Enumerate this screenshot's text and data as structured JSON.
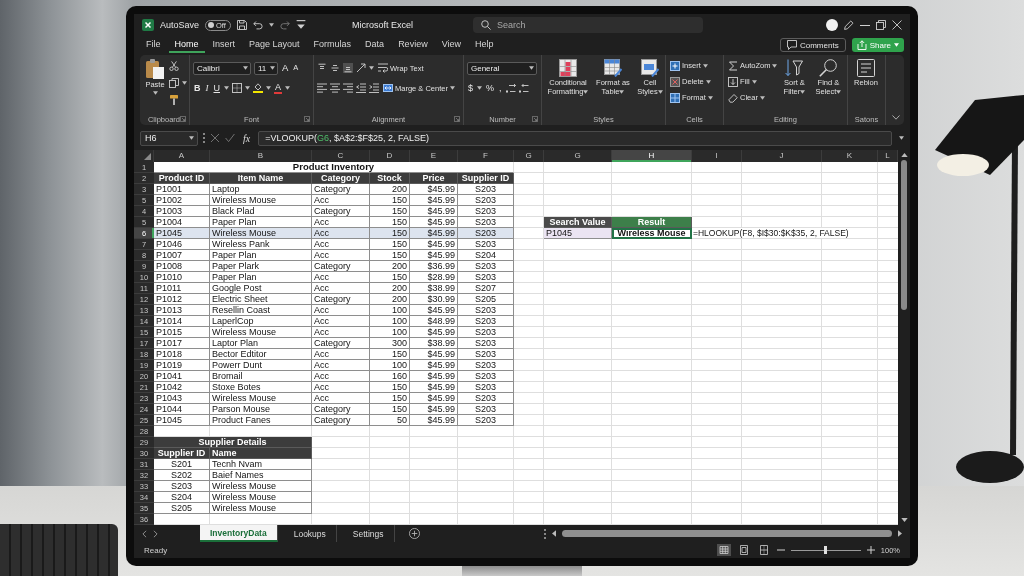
{
  "title_bar": {
    "autosave": {
      "label": "AutoSave",
      "toggle_text": "Off",
      "on": false
    },
    "title": "Microsoft Excel",
    "search": {
      "placeholder": "Search"
    }
  },
  "menu": {
    "tabs": [
      {
        "label": "File",
        "selected": false
      },
      {
        "label": "Home",
        "selected": true
      },
      {
        "label": "Insert",
        "selected": false
      },
      {
        "label": "Page Layout",
        "selected": false
      },
      {
        "label": "Formulas",
        "selected": false
      },
      {
        "label": "Data",
        "selected": false
      },
      {
        "label": "Review",
        "selected": false
      },
      {
        "label": "View",
        "selected": false
      },
      {
        "label": "Help",
        "selected": false
      }
    ],
    "comments": "Comments",
    "share": "Share"
  },
  "ribbon": {
    "groups": [
      {
        "kind": "clipboard",
        "label": "Clipboard",
        "paste": "Paste"
      },
      {
        "kind": "font",
        "label": "Font",
        "font_name": "Calibri",
        "font_size": "11",
        "size_buttons": [
          "A",
          "A"
        ],
        "style_buttons": [
          "B",
          "I",
          "U"
        ],
        "font_color": "A"
      },
      {
        "kind": "alignment",
        "label": "Alignment",
        "vertical_align": [
          {
            "selected": false
          },
          {
            "selected": false
          },
          {
            "selected": true
          }
        ],
        "wrap_text": "Wrap Text",
        "merge": "Marge & Center"
      },
      {
        "kind": "number",
        "label": "Number",
        "format": "General",
        "symbols": [
          "$",
          "%",
          ","
        ]
      },
      {
        "kind": "styles",
        "label": "Styles",
        "buttons": [
          "Conditional Formatting",
          "Format as Table",
          "Cell Styles"
        ]
      },
      {
        "kind": "cells",
        "label": "Cells",
        "buttons": [
          "Insert",
          "Delete",
          "Format"
        ]
      },
      {
        "kind": "editing",
        "label": "Editing",
        "list": [
          "AutoZom",
          "Fill",
          "Clear"
        ],
        "buttons": [
          "Sort & Filter",
          "Find & Select"
        ]
      },
      {
        "kind": "addins",
        "label": "Satons",
        "buttons": [
          "Rebion"
        ]
      }
    ]
  },
  "formula_bar": {
    "name_box": "H6",
    "fx": "fx",
    "formula": [
      {
        "text": "=VLOOKUP(",
        "ref": false
      },
      {
        "text": "G6",
        "ref": true
      },
      {
        "text": ", $A$2:$F$25, 2, FALSE)",
        "ref": false
      }
    ]
  },
  "sheet": {
    "columns": [
      {
        "label": "A",
        "selected": false
      },
      {
        "label": "B",
        "selected": false
      },
      {
        "label": "C",
        "selected": false
      },
      {
        "label": "D",
        "selected": false
      },
      {
        "label": "E",
        "selected": false
      },
      {
        "label": "F",
        "selected": false
      },
      {
        "label": "G",
        "selected": false
      },
      {
        "label": "G",
        "selected": false
      },
      {
        "label": "H",
        "selected": true
      },
      {
        "label": "I",
        "selected": false
      },
      {
        "label": "J",
        "selected": false
      },
      {
        "label": "K",
        "selected": false
      },
      {
        "label": "L",
        "selected": false
      }
    ],
    "inventory": {
      "title_row": "1",
      "title": "Product Inventory",
      "header_row": "2",
      "headers": [
        "Product ID",
        "Item Name",
        "Category",
        "Stock",
        "Price",
        "Supplier ID"
      ],
      "rows": [
        {
          "row": "3",
          "cells": [
            "P1001",
            "Laptop",
            "Category",
            "200",
            "$45.99",
            "S203"
          ],
          "selected": false
        },
        {
          "row": "5",
          "cells": [
            "P1002",
            "Wireless Mouse",
            "Acc",
            "150",
            "$45.99",
            "S203"
          ],
          "selected": false
        },
        {
          "row": "4",
          "cells": [
            "P1003",
            "Black Plad",
            "Category",
            "150",
            "$45.99",
            "S203"
          ],
          "selected": false
        },
        {
          "row": "5",
          "cells": [
            "P1004",
            "Paper Plan",
            "Acc",
            "150",
            "$45.99",
            "S203"
          ],
          "selected": false
        },
        {
          "row": "6",
          "cells": [
            "P1045",
            "Wireless Mouse",
            "Acc",
            "150",
            "$45.99",
            "S203"
          ],
          "selected": true
        },
        {
          "row": "7",
          "cells": [
            "P1046",
            "Wireless Pank",
            "Acc",
            "150",
            "$45.99",
            "S203"
          ],
          "selected": false
        },
        {
          "row": "8",
          "cells": [
            "P1007",
            "Paper Plan",
            "Acc",
            "150",
            "$45.99",
            "S204"
          ],
          "selected": false
        },
        {
          "row": "9",
          "cells": [
            "P1008",
            "Paper Plark",
            "Category",
            "200",
            "$36.99",
            "S203"
          ],
          "selected": false
        },
        {
          "row": "10",
          "cells": [
            "P1010",
            "Paper Plan",
            "Acc",
            "150",
            "$28.99",
            "S203"
          ],
          "selected": false
        },
        {
          "row": "11",
          "cells": [
            "P1011",
            "Google Post",
            "Acc",
            "200",
            "$38.99",
            "S207"
          ],
          "selected": false
        },
        {
          "row": "12",
          "cells": [
            "P1012",
            "Electric Sheet",
            "Category",
            "200",
            "$30.99",
            "S205"
          ],
          "selected": false
        },
        {
          "row": "13",
          "cells": [
            "P1013",
            "Resellin Coast",
            "Acc",
            "100",
            "$45.99",
            "S203"
          ],
          "selected": false
        },
        {
          "row": "14",
          "cells": [
            "P1014",
            "LaperlCop",
            "Acc",
            "100",
            "$48.99",
            "S203"
          ],
          "selected": false
        },
        {
          "row": "15",
          "cells": [
            "P1015",
            "Wireless Mouse",
            "Acc",
            "100",
            "$45.99",
            "S203"
          ],
          "selected": false
        },
        {
          "row": "17",
          "cells": [
            "P1017",
            "Laptor Plan",
            "Category",
            "300",
            "$38.99",
            "S203"
          ],
          "selected": false
        },
        {
          "row": "18",
          "cells": [
            "P1018",
            "Bector Edtitor",
            "Acc",
            "150",
            "$45.99",
            "S203"
          ],
          "selected": false
        },
        {
          "row": "19",
          "cells": [
            "P1019",
            "Powerr Dunt",
            "Acc",
            "100",
            "$45.99",
            "S203"
          ],
          "selected": false
        },
        {
          "row": "20",
          "cells": [
            "P1041",
            "Bromail",
            "Acc",
            "160",
            "$45.99",
            "S203"
          ],
          "selected": false
        },
        {
          "row": "21",
          "cells": [
            "P1042",
            "Stoxe Botes",
            "Acc",
            "150",
            "$45.99",
            "S203"
          ],
          "selected": false
        },
        {
          "row": "23",
          "cells": [
            "P1043",
            "Wireless Mouse",
            "Acc",
            "150",
            "$45.99",
            "S203"
          ],
          "selected": false
        },
        {
          "row": "24",
          "cells": [
            "P1044",
            "Parson Mouse",
            "Category",
            "150",
            "$45.99",
            "S203"
          ],
          "selected": false
        },
        {
          "row": "25",
          "cells": [
            "P1045",
            "Product Fanes",
            "Category",
            "50",
            "$45.99",
            "S203"
          ],
          "selected": false
        }
      ]
    },
    "lookup": {
      "headers": [
        {
          "text": "Search Value",
          "color": "#4a4a4a"
        },
        {
          "text": "Result",
          "color": "#3d7f4a"
        }
      ],
      "search_value": "P1045",
      "result": "Wireless Mouse",
      "result_selected": true,
      "formula_text": "=HLOOKUP(F8, $I$30:$K$35, 2, FALSE)"
    },
    "gap_row": "28",
    "suppliers": {
      "title_row": "29",
      "title": "Supplier Details",
      "header_row": "30",
      "headers": [
        "Supplier ID",
        "Name"
      ],
      "rows": [
        {
          "row": "31",
          "cells": [
            "S201",
            "Tecnh Nvam"
          ]
        },
        {
          "row": "32",
          "cells": [
            "S202",
            "Baief Names"
          ]
        },
        {
          "row": "33",
          "cells": [
            "S203",
            "Wireless Mouse"
          ]
        },
        {
          "row": "34",
          "cells": [
            "S204",
            "Wireless Mouse"
          ]
        },
        {
          "row": "35",
          "cells": [
            "S205",
            "Wireless Mouse"
          ]
        }
      ]
    },
    "end_row": "36"
  },
  "sheet_tabs": {
    "tabs": [
      {
        "label": "InventoryData",
        "selected": true
      },
      {
        "label": "Lookups",
        "selected": false
      },
      {
        "label": "Settings",
        "selected": false
      }
    ]
  },
  "status_bar": {
    "status": "Ready",
    "views": [
      {
        "selected": true
      },
      {
        "selected": false
      },
      {
        "selected": false
      }
    ],
    "zoom": {
      "label": "100%",
      "level": 0.5
    }
  }
}
